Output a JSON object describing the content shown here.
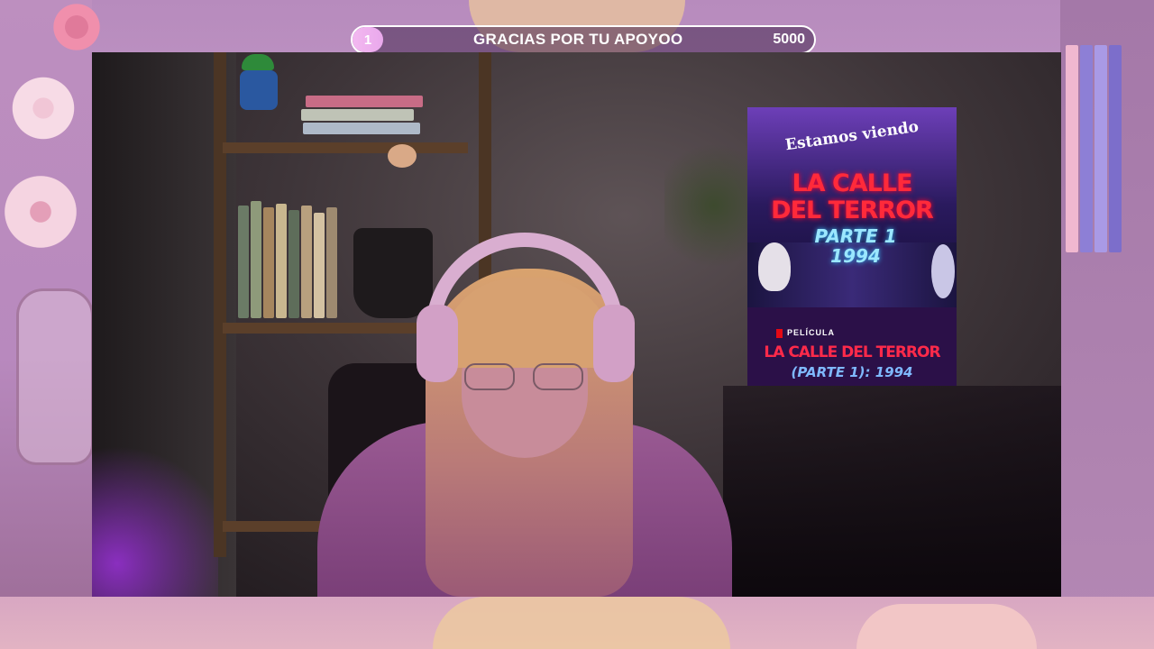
{
  "alert_bar": {
    "count": "1",
    "message": "GRACIAS POR TU APOYOO",
    "goal": "5000"
  },
  "poster": {
    "tagline": "Estamos viendo",
    "title_line1": "LA CALLE",
    "title_line2": "DEL TERROR",
    "subtitle_line1": "PARTE 1",
    "subtitle_line2": "1994",
    "label": "PELÍCULA",
    "title_bottom": "LA CALLE DEL TERROR",
    "subtitle_bottom": "(PARTE 1): 1994"
  },
  "colors": {
    "background": "#c89ac4",
    "alert_border": "#ffffff",
    "alert_count_bg": "#f3b8f0",
    "poster_title": "#ff2a3a",
    "poster_subtitle": "#9be7ff"
  }
}
